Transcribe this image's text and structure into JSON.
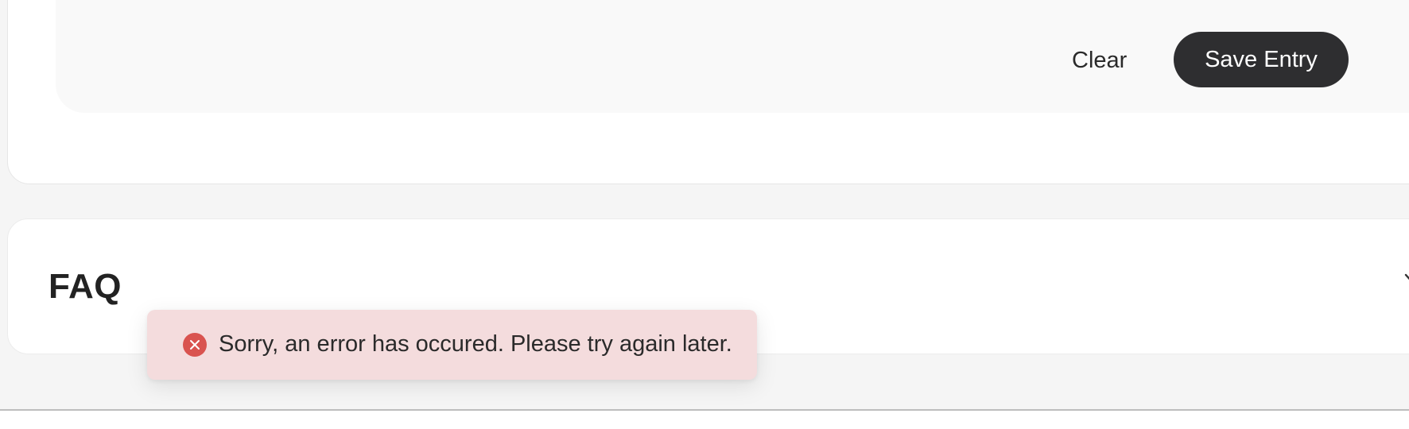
{
  "entry_form": {
    "clear_label": "Clear",
    "save_label": "Save Entry"
  },
  "faq": {
    "title": "FAQ",
    "chevron_icon": "chevron-down-icon"
  },
  "toast": {
    "type": "error",
    "icon": "close-circle-icon",
    "message": "Sorry, an error has occured. Please try again later.",
    "background_color": "#f4dcdd",
    "icon_color": "#d9534f"
  },
  "colors": {
    "page_background": "#f5f5f5",
    "card_background": "#ffffff",
    "primary_button": "#2e2e30"
  }
}
